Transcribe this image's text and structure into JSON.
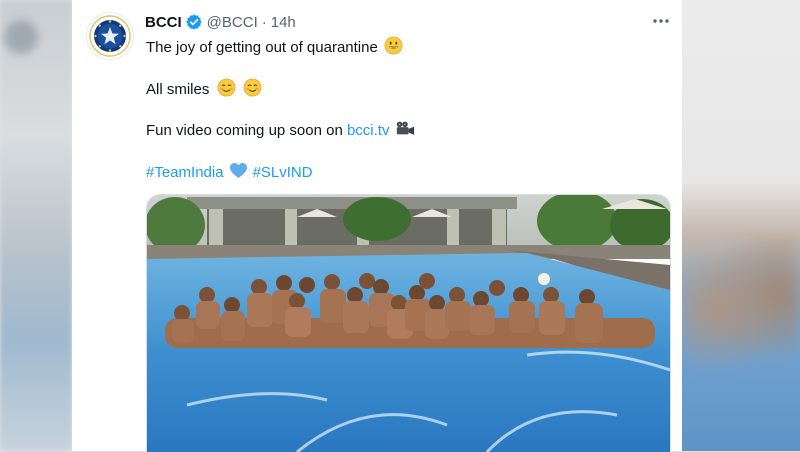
{
  "tweet": {
    "author_name": "BCCI",
    "handle": "@BCCI",
    "separator": "·",
    "time": "14h",
    "lines": {
      "line1": "The joy of getting out of quarantine",
      "line2": "All smiles",
      "line3_prefix": "Fun video coming up soon on ",
      "line3_link": "bcci.tv",
      "hashtag1": "#TeamIndia",
      "hashtag2": "#SLvIND"
    },
    "more_icon": "more-horizontal-icon"
  },
  "colors": {
    "link": "#1d9bf0",
    "verified": "#1d9bf0",
    "text": "#0f1419",
    "muted": "#536471"
  }
}
